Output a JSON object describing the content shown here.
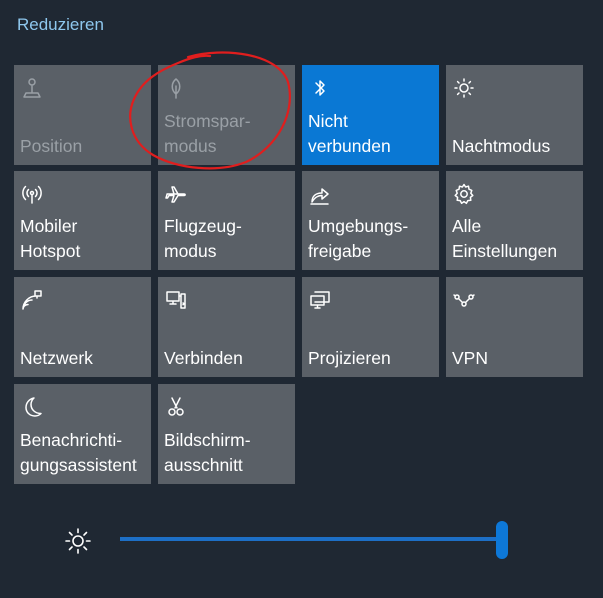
{
  "header": {
    "collapse_label": "Reduzieren"
  },
  "tiles": [
    {
      "id": "position",
      "lines": [
        "Position"
      ],
      "icon": "location-icon",
      "state": "disabled"
    },
    {
      "id": "battery-saver",
      "lines": [
        "Stromspar-",
        "modus"
      ],
      "icon": "leaf-icon",
      "state": "disabled"
    },
    {
      "id": "bluetooth",
      "lines": [
        "Nicht",
        "verbunden"
      ],
      "icon": "bluetooth-icon",
      "state": "active"
    },
    {
      "id": "night-mode",
      "lines": [
        "Nachtmodus"
      ],
      "icon": "night-light-icon",
      "state": "normal"
    },
    {
      "id": "mobile-hotspot",
      "lines": [
        "Mobiler",
        "Hotspot"
      ],
      "icon": "hotspot-icon",
      "state": "normal"
    },
    {
      "id": "airplane-mode",
      "lines": [
        "Flugzeug-",
        "modus"
      ],
      "icon": "airplane-icon",
      "state": "normal"
    },
    {
      "id": "nearby-sharing",
      "lines": [
        "Umgebungs-",
        "freigabe"
      ],
      "icon": "share-icon",
      "state": "normal"
    },
    {
      "id": "all-settings",
      "lines": [
        "Alle",
        "Einstellungen"
      ],
      "icon": "gear-icon",
      "state": "normal"
    },
    {
      "id": "network",
      "lines": [
        "Netzwerk"
      ],
      "icon": "network-icon",
      "state": "normal"
    },
    {
      "id": "connect",
      "lines": [
        "Verbinden"
      ],
      "icon": "connect-icon",
      "state": "normal"
    },
    {
      "id": "project",
      "lines": [
        "Projizieren"
      ],
      "icon": "project-icon",
      "state": "normal"
    },
    {
      "id": "vpn",
      "lines": [
        "VPN"
      ],
      "icon": "vpn-icon",
      "state": "normal"
    },
    {
      "id": "focus-assist",
      "lines": [
        "Benachrichti-",
        "gungsassistent"
      ],
      "icon": "moon-icon",
      "state": "normal"
    },
    {
      "id": "snip",
      "lines": [
        "Bildschirm-",
        "ausschnitt"
      ],
      "icon": "scissors-icon",
      "state": "normal"
    }
  ],
  "brightness": {
    "icon": "brightness-icon",
    "level": 1.0
  },
  "colors": {
    "accent": "#0a78d4",
    "tile": "#5a6067",
    "background": "#1f2833",
    "annotation": "#e01e1e"
  }
}
